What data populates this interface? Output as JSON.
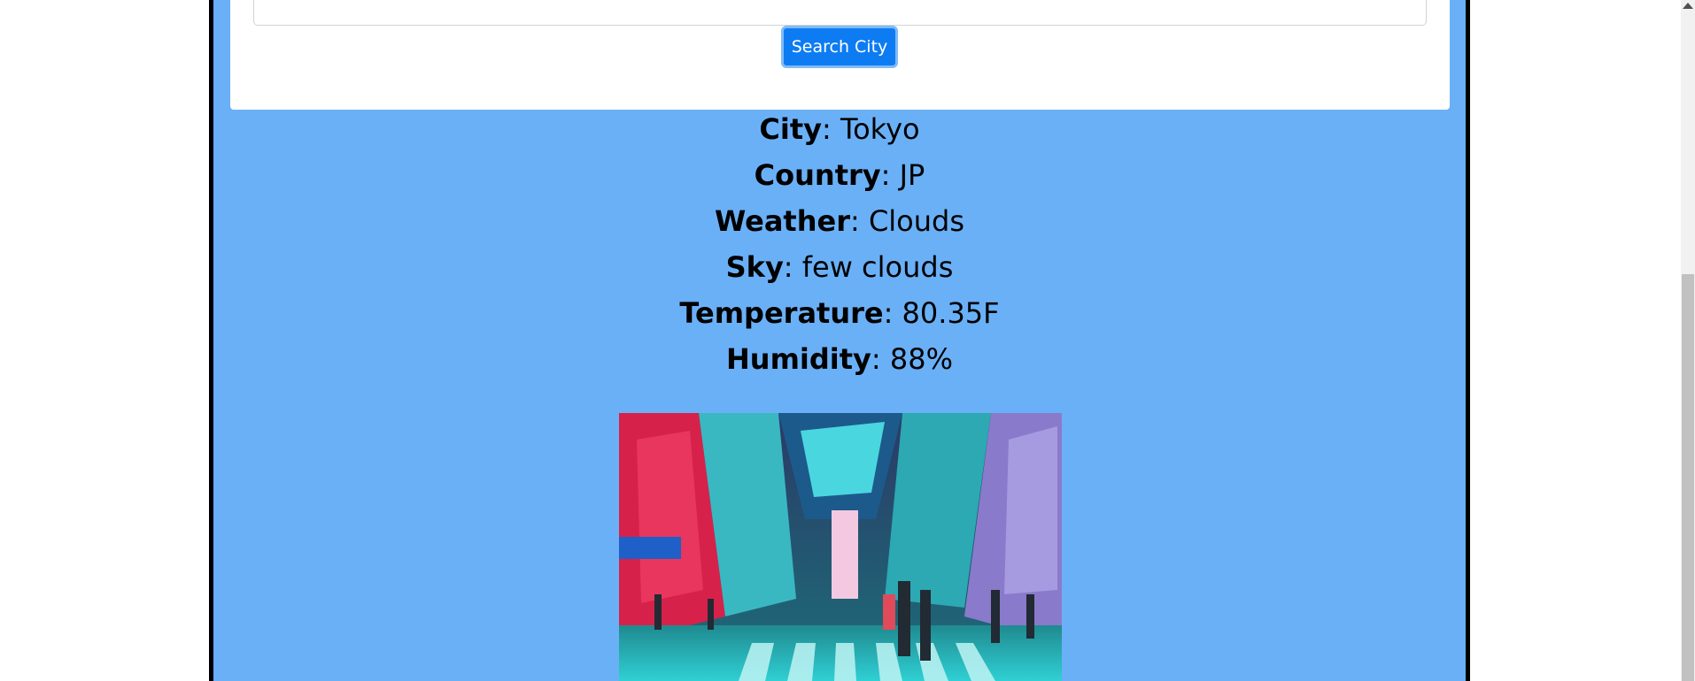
{
  "search": {
    "button_label": "Search City",
    "input_value": ""
  },
  "weather": {
    "city_label": "City",
    "city_value": ": Tokyo",
    "country_label": "Country",
    "country_value": ": JP",
    "weather_label": "Weather",
    "weather_value": ": Clouds",
    "sky_label": "Sky",
    "sky_value": ": few clouds",
    "temperature_label": "Temperature",
    "temperature_value": ": 80.35F",
    "humidity_label": "Humidity",
    "humidity_value": ": 88%"
  },
  "image": {
    "subject": "tokyo-street-scene"
  },
  "colors": {
    "panel_bg": "#6ab0f7",
    "button_bg": "#0d7cf2"
  }
}
